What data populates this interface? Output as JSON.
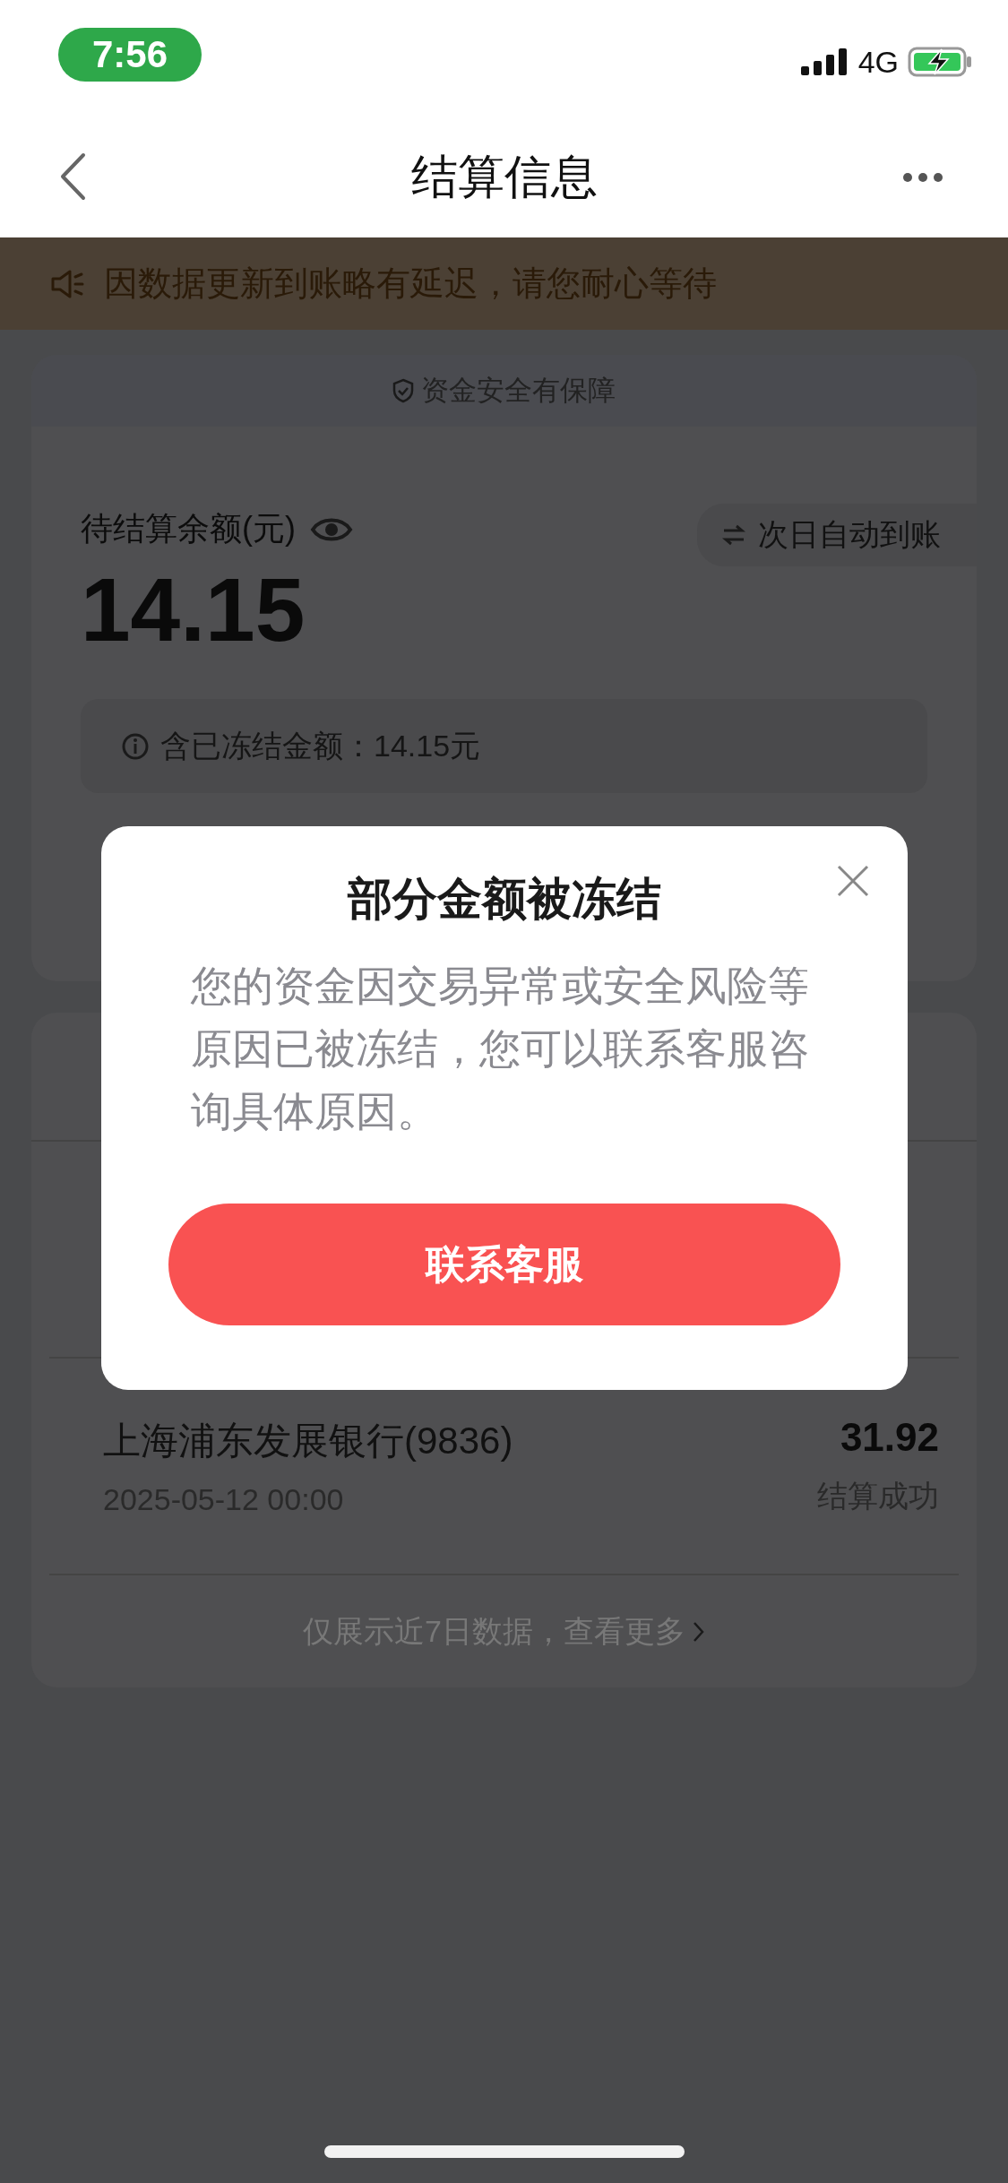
{
  "status_bar": {
    "time": "7:56",
    "network": "4G"
  },
  "nav": {
    "title": "结算信息"
  },
  "notice": {
    "text": "因数据更新到账略有延迟，请您耐心等待"
  },
  "balance_card": {
    "security_text": "资金安全有保障",
    "label": "待结算余额(元)",
    "amount": "14.15",
    "payout_button": "次日自动到账",
    "frozen_note": "含已冻结金额：14.15元"
  },
  "records": {
    "rows": [
      {
        "bank": "上海浦东发展银行(9836)",
        "time": "2025-05-12 00:00",
        "amount": "31.92",
        "status": "结算成功"
      }
    ],
    "footer": "仅展示近7日数据，查看更多"
  },
  "dialog": {
    "title": "部分金额被冻结",
    "message": "您的资金因交易异常或安全风险等原因已被冻结，您可以联系客服咨询具体原因。",
    "button": "联系客服"
  }
}
